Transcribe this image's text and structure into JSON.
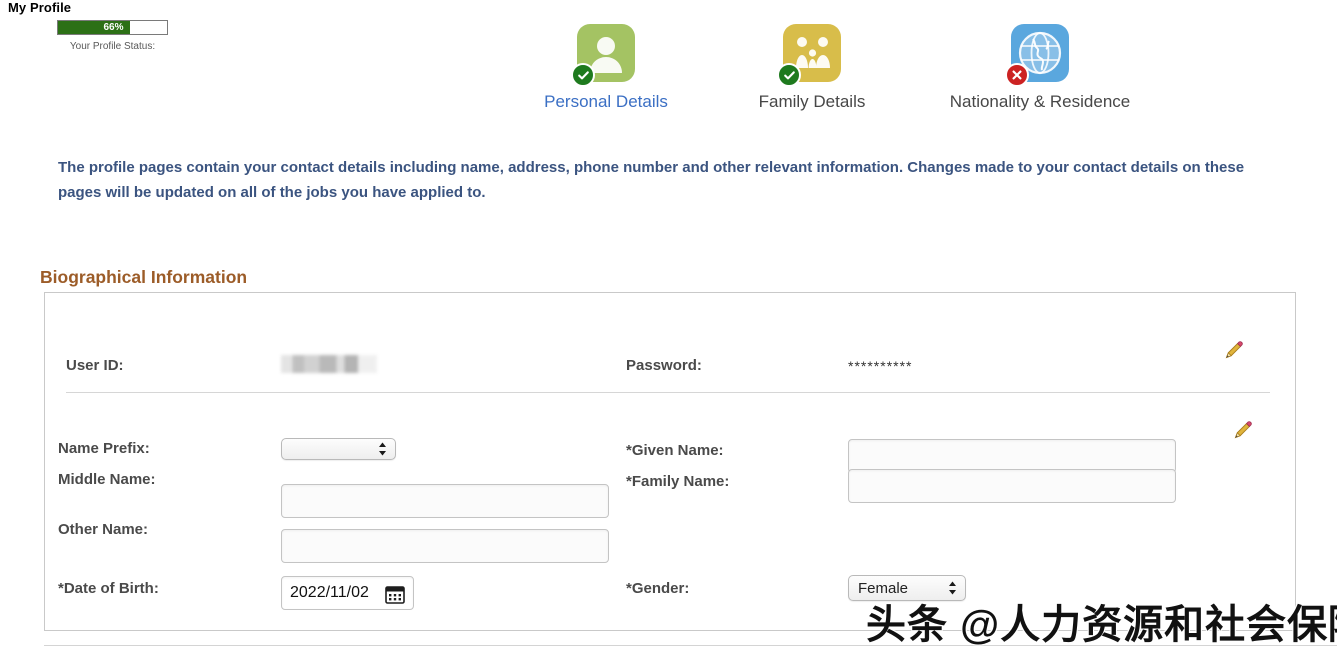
{
  "header": {
    "page_title": "My Profile",
    "progress": {
      "percent_label": "66%",
      "percent_value": 66,
      "caption": "Your Profile Status:",
      "fill_color": "#2c7016"
    }
  },
  "tabs": [
    {
      "label": "Personal Details",
      "icon": "person-icon",
      "icon_color": "#a4c363",
      "state": "complete",
      "badge": "check-badge-icon",
      "active": true
    },
    {
      "label": "Family Details",
      "icon": "family-icon",
      "icon_color": "#d8bd4a",
      "state": "complete",
      "badge": "check-badge-icon",
      "active": false
    },
    {
      "label": "Nationality & Residence",
      "icon": "globe-icon",
      "icon_color": "#5aa7de",
      "state": "incomplete",
      "badge": "error-badge-icon",
      "active": false
    }
  ],
  "intro": {
    "text": "The profile pages contain your contact details including name, address, phone number and other relevant information. Changes made to your contact details on these pages will be updated on all of the jobs you have applied to.",
    "color": "#3b5480"
  },
  "section": {
    "title": "Biographical Information",
    "title_color": "#9c5c28"
  },
  "fields": {
    "user_id": {
      "label": "User ID:",
      "value": "",
      "redacted": true
    },
    "password": {
      "label": "Password:",
      "value": "**********"
    },
    "name_prefix": {
      "label": "Name Prefix:",
      "value": "",
      "type": "select"
    },
    "middle_name": {
      "label": "Middle Name:",
      "value": "",
      "type": "text"
    },
    "other_name": {
      "label": "Other Name:",
      "value": "",
      "type": "text"
    },
    "date_of_birth": {
      "label": "*Date of Birth:",
      "value": "2022/11/02",
      "type": "date"
    },
    "given_name": {
      "label": "*Given Name:",
      "value": "",
      "type": "text"
    },
    "family_name": {
      "label": "*Family Name:",
      "value": "",
      "type": "text"
    },
    "gender": {
      "label": "*Gender:",
      "value": "Female",
      "type": "select"
    }
  },
  "edit_buttons": [
    {
      "name": "edit-credentials-pencil",
      "icon": "pencil-icon"
    },
    {
      "name": "edit-name-pencil",
      "icon": "pencil-icon"
    }
  ],
  "watermark": {
    "text": "头条 @人力资源和社会保障部"
  }
}
